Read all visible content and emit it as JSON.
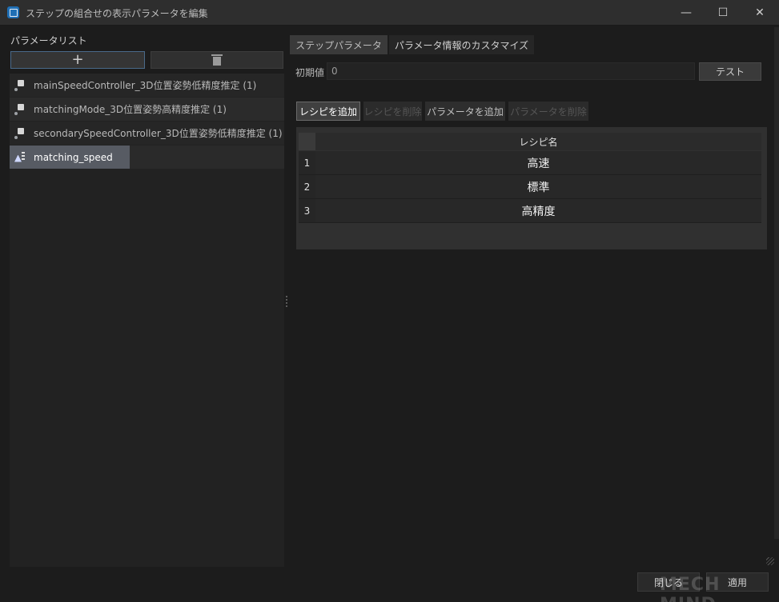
{
  "window": {
    "title": "ステップの組合せの表示パラメータを編集",
    "controls": {
      "minimize": "—",
      "maximize": "☐",
      "close": "✕"
    }
  },
  "left_panel": {
    "label": "パラメータリスト",
    "add_label": "+",
    "items": [
      {
        "label": "mainSpeedController_3D位置姿勢低精度推定 (1)"
      },
      {
        "label": "matchingMode_3D位置姿勢高精度推定 (1)"
      },
      {
        "label": "secondarySpeedController_3D位置姿勢低精度推定 (1)"
      },
      {
        "label": "matching_speed",
        "selected": true
      }
    ]
  },
  "right_panel": {
    "tabs": [
      {
        "label": "ステップパラメータ"
      },
      {
        "label": "パラメータ情報のカスタマイズ",
        "active": true
      }
    ],
    "initial_value": {
      "label": "初期値",
      "value": "0"
    },
    "test_label": "テスト",
    "buttons": {
      "add_recipe": "レシピを追加",
      "delete_recipe": "レシピを削除",
      "add_param": "パラメータを追加",
      "delete_param": "パラメータを削除"
    },
    "table": {
      "header": "レシピ名",
      "rows": [
        {
          "num": "1",
          "name": "高速"
        },
        {
          "num": "2",
          "name": "標準"
        },
        {
          "num": "3",
          "name": "高精度"
        }
      ]
    }
  },
  "footer": {
    "close_label": "閉じる",
    "apply_label": "適用",
    "watermark": "MECH MIND"
  },
  "colors": {
    "background": "#1c1c1c",
    "selected_item": "#575b63",
    "add_button_border": "#4a6a8a"
  }
}
